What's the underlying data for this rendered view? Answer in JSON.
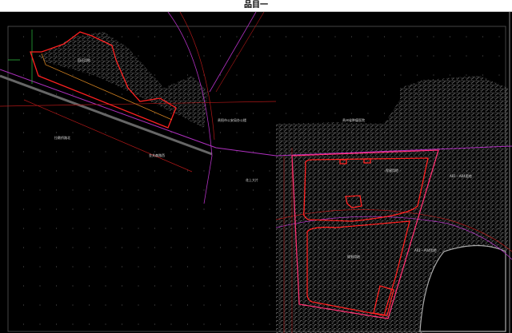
{
  "title": "品目一",
  "colors": {
    "background": "#000000",
    "boundary": "#ff2020",
    "road": "#b01818",
    "rail": "#b030c0",
    "linework": "#d0d0d0"
  },
  "labels": {
    "relocation_site": "回迁用地",
    "public_security": "贵阳市公安局办公楼",
    "hospital": "贵州省肿瘤医院",
    "road_north": "拉歌桥路北",
    "road_west": "金关森路西",
    "area_center": "花上大片",
    "site_a": "保留用地",
    "site_a01_upper": "A01－A04用地",
    "site_a01_lower": "A01－A04用地",
    "site_south": "规划用地"
  }
}
